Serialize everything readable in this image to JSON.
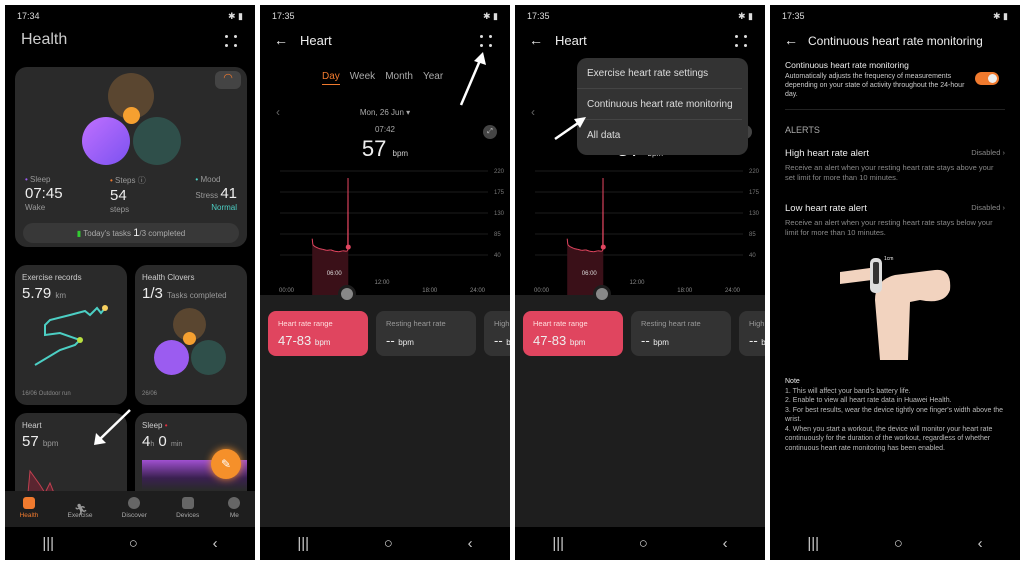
{
  "panel1": {
    "status_time": "17:34",
    "title": "Health",
    "sleep": {
      "label": "Sleep",
      "value": "07:45",
      "sub": "Wake"
    },
    "steps": {
      "label": "Steps",
      "value": "54",
      "sub": "steps"
    },
    "mood": {
      "label": "Mood",
      "stress_label": "Stress",
      "value": "41",
      "sub": "Normal"
    },
    "tasks": {
      "label": "Today's tasks",
      "done": "1",
      "rest": "/3 completed"
    },
    "exercise": {
      "title": "Exercise records",
      "value": "5.79",
      "unit": "km",
      "footer": "16/06  Outdoor run"
    },
    "clovers": {
      "title": "Health Clovers",
      "value": "1/3",
      "unit": "Tasks completed",
      "footer": "26/06"
    },
    "heart": {
      "title": "Heart",
      "value": "57",
      "unit": "bpm"
    },
    "sleep_card": {
      "title": "Sleep",
      "h": "4",
      "h_unit": "h",
      "m": "0",
      "m_unit": "min"
    },
    "nav": [
      "Health",
      "Exercise",
      "Discover",
      "Devices",
      "Me"
    ]
  },
  "heart": {
    "status_time": "17:35",
    "title": "Heart",
    "tabs": [
      "Day",
      "Week",
      "Month",
      "Year"
    ],
    "date": "Mon, 26 Jun",
    "time": "07:42",
    "value": "57",
    "unit": "bpm",
    "cursor_label": "06:00",
    "cards": [
      {
        "title": "Heart rate range",
        "value": "47-83",
        "unit": "bpm"
      },
      {
        "title": "Resting heart rate",
        "value": "--",
        "unit": "bpm"
      },
      {
        "title": "High",
        "value": "--",
        "unit": "bp"
      }
    ]
  },
  "chart_data": {
    "type": "line",
    "y_ticks": [
      "220",
      "175",
      "130",
      "85",
      "40"
    ],
    "x_ticks": [
      "00:00",
      "12:00",
      "18:00",
      "24:00"
    ],
    "ylim": [
      40,
      220
    ],
    "xlim_hours": [
      0,
      24
    ],
    "series": [
      {
        "x": [
          "03:10",
          "03:15",
          "03:30",
          "04:00",
          "04:30",
          "05:00",
          "05:30",
          "06:00",
          "06:30",
          "07:00",
          "07:30",
          "07:38",
          "07:40",
          "07:41",
          "07:42"
        ],
        "values": [
          75,
          62,
          58,
          54,
          52,
          50,
          51,
          48,
          47,
          49,
          48,
          50,
          205,
          55,
          57
        ]
      }
    ],
    "color": "#e0455f"
  },
  "menu": [
    "Exercise heart rate settings",
    "Continuous heart rate monitoring",
    "All data"
  ],
  "panel4": {
    "status_time": "17:35",
    "title": "Continuous heart rate monitoring",
    "cont_title": "Continuous heart rate monitoring",
    "cont_desc": "Automatically adjusts the frequency of measurements depending on your state of activity throughout the 24-hour day.",
    "toggle_on": true,
    "alerts_header": "ALERTS",
    "high": {
      "title": "High heart rate alert",
      "status": "Disabled",
      "desc": "Receive an alert when your resting heart rate stays above your set limit for more than 10 minutes."
    },
    "low": {
      "title": "Low heart rate alert",
      "status": "Disabled",
      "desc": "Receive an alert when your resting heart rate stays below your limit for more than 10 minutes."
    },
    "note_title": "Note",
    "notes": [
      "1. This will affect your band's battery life.",
      "2. Enable to view all heart rate data in Huawei Health.",
      "3. For best results, wear the device tightly one finger's width above the wrist.",
      "4. When you start a workout, the device will monitor your heart rate continuously for the duration of the workout, regardless of whether continuous heart rate monitoring has been enabled."
    ]
  },
  "colors": {
    "accent": "#f07a2e",
    "pink": "#e0455f",
    "purple": "#9b5cf0",
    "green": "#2f4f4a",
    "brown": "#5a4630",
    "teal": "#4ccfc4"
  }
}
